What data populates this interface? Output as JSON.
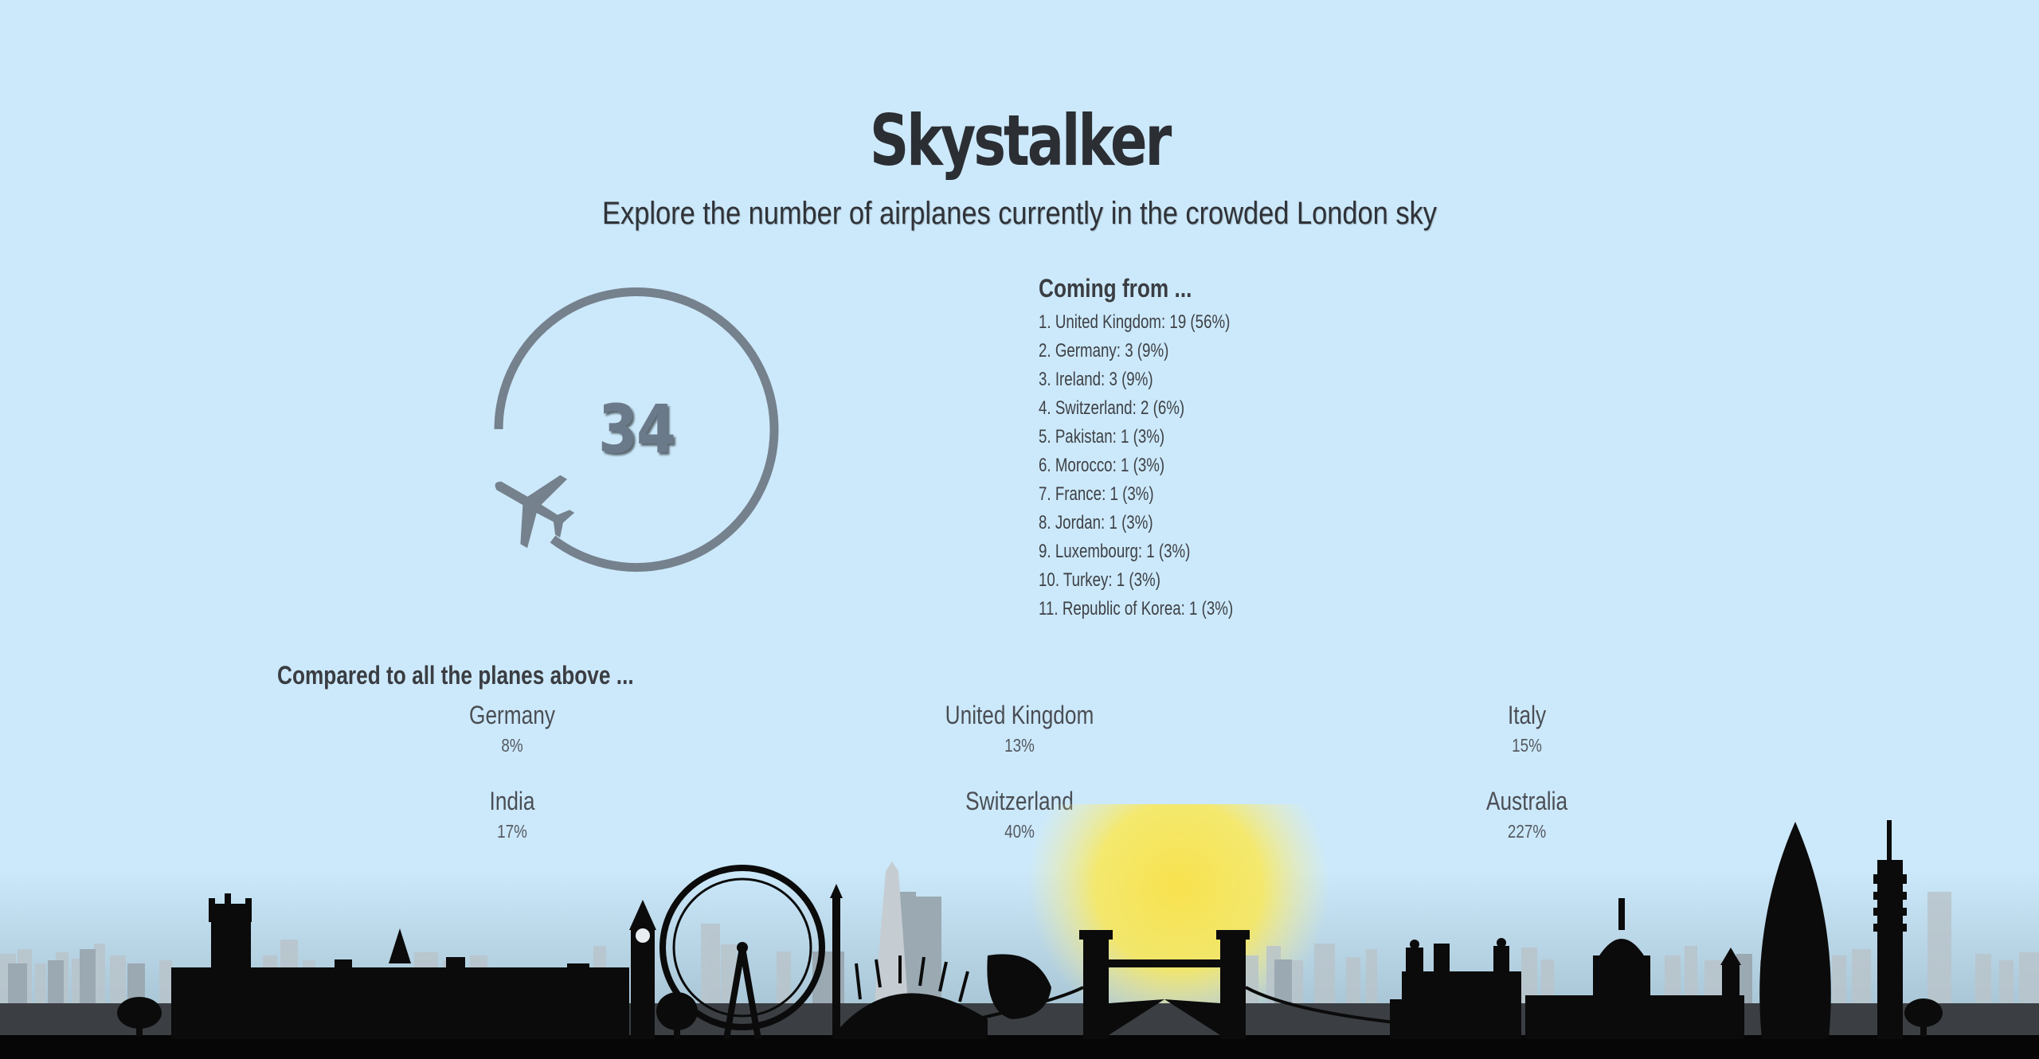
{
  "header": {
    "title": "Skystalker",
    "subtitle": "Explore the number of airplanes currently in the crowded London sky"
  },
  "counter": {
    "value": "34",
    "icon": "airplane-icon",
    "ring_color": "#75818d"
  },
  "origins": {
    "heading": "Coming from ...",
    "items": [
      "1. United Kingdom: 19 (56%)",
      "2. Germany: 3 (9%)",
      "3. Ireland: 3 (9%)",
      "4. Switzerland: 2 (6%)",
      "5. Pakistan: 1 (3%)",
      "6. Morocco: 1 (3%)",
      "7. France: 1 (3%)",
      "8. Jordan: 1 (3%)",
      "9. Luxembourg: 1 (3%)",
      "10. Turkey: 1 (3%)",
      "11. Republic of Korea: 1 (3%)"
    ]
  },
  "comparison": {
    "heading": "Compared to all the planes above ...",
    "items": [
      {
        "country": "Germany",
        "percent": "8%"
      },
      {
        "country": "United Kingdom",
        "percent": "13%"
      },
      {
        "country": "Italy",
        "percent": "15%"
      },
      {
        "country": "India",
        "percent": "17%"
      },
      {
        "country": "Switzerland",
        "percent": "40%"
      },
      {
        "country": "Australia",
        "percent": "227%"
      }
    ]
  },
  "colors": {
    "sky": "#cce9fb",
    "sun": "#f7e45a",
    "skyline": "#0a0a0a"
  }
}
